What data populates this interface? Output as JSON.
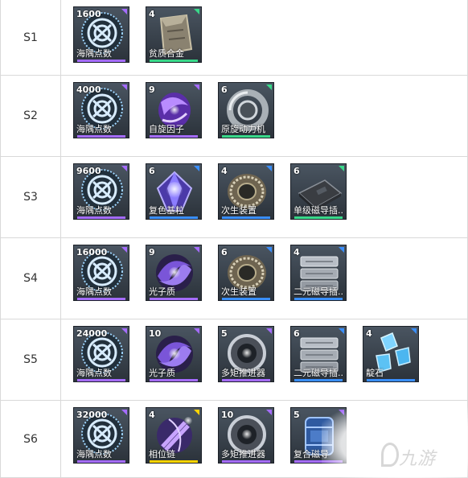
{
  "colors": {
    "purple": "#a56cff",
    "green": "#39d98a",
    "blue": "#3a8fff",
    "yellow": "#ffd400"
  },
  "rows": [
    {
      "stage": "S1",
      "items": [
        {
          "count": "1600",
          "name": "海隅点数",
          "icon": "emblem-icon",
          "rarity": "purple"
        },
        {
          "count": "4",
          "name": "贫质合金",
          "icon": "alloy-block-icon",
          "rarity": "green"
        }
      ]
    },
    {
      "stage": "S2",
      "items": [
        {
          "count": "4000",
          "name": "海隅点数",
          "icon": "emblem-icon",
          "rarity": "purple"
        },
        {
          "count": "9",
          "name": "自旋因子",
          "icon": "spin-factor-icon",
          "rarity": "purple"
        },
        {
          "count": "6",
          "name": "原旋动力机",
          "icon": "ring-engine-icon",
          "rarity": "green"
        }
      ]
    },
    {
      "stage": "S3",
      "items": [
        {
          "count": "9600",
          "name": "海隅点数",
          "icon": "emblem-icon",
          "rarity": "purple"
        },
        {
          "count": "6",
          "name": "复色基粒",
          "icon": "crystal-icon",
          "rarity": "blue"
        },
        {
          "count": "4",
          "name": "次生装置",
          "icon": "ring-device-icon",
          "rarity": "blue"
        },
        {
          "count": "6",
          "name": "单级磁导插...",
          "icon": "plate-icon",
          "rarity": "green"
        }
      ]
    },
    {
      "stage": "S4",
      "items": [
        {
          "count": "16000",
          "name": "海隅点数",
          "icon": "emblem-icon",
          "rarity": "purple"
        },
        {
          "count": "9",
          "name": "光子质",
          "icon": "photon-icon",
          "rarity": "purple"
        },
        {
          "count": "6",
          "name": "次生装置",
          "icon": "ring-device-icon",
          "rarity": "blue"
        },
        {
          "count": "4",
          "name": "二元磁导插...",
          "icon": "stack-icon",
          "rarity": "blue"
        }
      ]
    },
    {
      "stage": "S5",
      "items": [
        {
          "count": "24000",
          "name": "海隅点数",
          "icon": "emblem-icon",
          "rarity": "purple"
        },
        {
          "count": "10",
          "name": "光子质",
          "icon": "photon-icon",
          "rarity": "purple"
        },
        {
          "count": "5",
          "name": "多矩推进器",
          "icon": "thruster-icon",
          "rarity": "purple"
        },
        {
          "count": "6",
          "name": "二元磁导插...",
          "icon": "stack-icon",
          "rarity": "blue"
        },
        {
          "count": "4",
          "name": "靛石",
          "icon": "gem-icon",
          "rarity": "blue"
        }
      ]
    },
    {
      "stage": "S6",
      "items": [
        {
          "count": "32000",
          "name": "海隅点数",
          "icon": "emblem-icon",
          "rarity": "purple"
        },
        {
          "count": "4",
          "name": "相位链",
          "icon": "phase-chain-icon",
          "rarity": "yellow"
        },
        {
          "count": "10",
          "name": "多矩推进器",
          "icon": "thruster-icon",
          "rarity": "purple"
        },
        {
          "count": "5",
          "name": "复合磁导",
          "icon": "canister-icon",
          "rarity": "purple"
        }
      ]
    }
  ],
  "watermark": {
    "text": "九游"
  }
}
